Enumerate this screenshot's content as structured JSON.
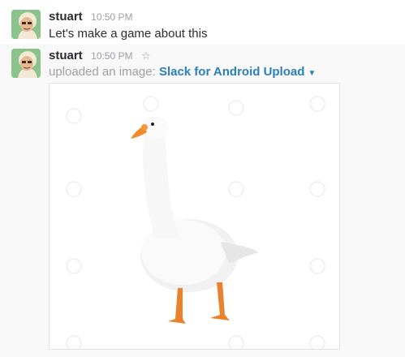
{
  "messages": [
    {
      "author": "stuart",
      "time": "10:50 PM",
      "text": "Let's make a game about this"
    },
    {
      "author": "stuart",
      "time": "10:50 PM",
      "star_icon": "☆",
      "action": "uploaded an image: ",
      "file_title": "Slack for Android Upload",
      "caret_icon": "▼"
    }
  ],
  "image_description": "photo-of-white-goose",
  "colors": {
    "link": "#2a80b9",
    "timestamp": "#9e9ea6",
    "avatar_bg": "#8bc48a"
  }
}
